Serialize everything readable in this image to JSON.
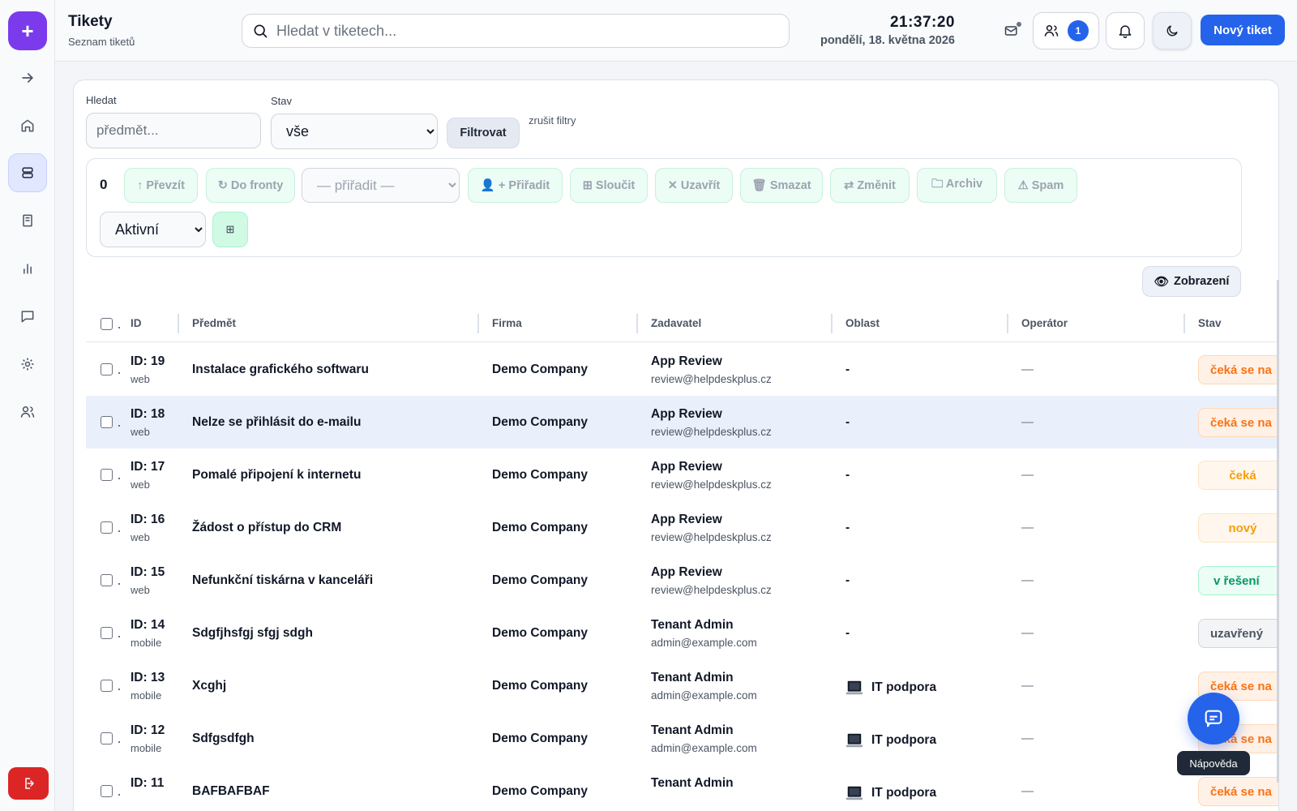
{
  "header": {
    "title": "Tikety",
    "subtitle": "Seznam tiketů",
    "search_placeholder": "Hledat v tiketech...",
    "time": "21:37:20",
    "date": "pondělí, 18. května 2026",
    "users_count": "1",
    "new_ticket_label": "Nový tiket"
  },
  "filters": {
    "search_label": "Hledat",
    "search_placeholder": "předmět...",
    "status_label": "Stav",
    "status_value": "vše",
    "filter_button": "Filtrovat",
    "clear_link": "zrušit filtry"
  },
  "bulk": {
    "selected_count": "0",
    "take_over": "↑ Převzít",
    "to_queue": "↻ Do fronty",
    "assign_select": "— přiřadit —",
    "assign_button": "👤 + Přiřadit",
    "merge": "⊞ Sloučit",
    "close": "✕ Uzavřít",
    "delete": "🗑 Smazat",
    "change": "⇄ Změnit",
    "archive": "🗀 Archiv",
    "spam": "⚠ Spam",
    "scope_select": "Aktivní",
    "grid_icon": "⊞"
  },
  "view_button": "Zobrazení",
  "table": {
    "columns": {
      "id": "ID",
      "subject": "Předmět",
      "company": "Firma",
      "requester": "Zadavatel",
      "area": "Oblast",
      "operator": "Operátor",
      "status": "Stav"
    },
    "rows": [
      {
        "id": "ID: 19",
        "source": "web",
        "subject": "Instalace grafického softwaru",
        "company": "Demo Company",
        "requester": "App Review",
        "email": "review@helpdeskplus.cz",
        "area": "-",
        "operator": "—",
        "status": "čeká se na"
      },
      {
        "id": "ID: 18",
        "source": "web",
        "subject": "Nelze se přihlásit do e-mailu",
        "company": "Demo Company",
        "requester": "App Review",
        "email": "review@helpdeskplus.cz",
        "area": "-",
        "operator": "—",
        "status": "čeká se na"
      },
      {
        "id": "ID: 17",
        "source": "web",
        "subject": "Pomalé připojení k internetu",
        "company": "Demo Company",
        "requester": "App Review",
        "email": "review@helpdeskplus.cz",
        "area": "-",
        "operator": "—",
        "status": "čeká"
      },
      {
        "id": "ID: 16",
        "source": "web",
        "subject": "Žádost o přístup do CRM",
        "company": "Demo Company",
        "requester": "App Review",
        "email": "review@helpdeskplus.cz",
        "area": "-",
        "operator": "—",
        "status": "nový"
      },
      {
        "id": "ID: 15",
        "source": "web",
        "subject": "Nefunkční tiskárna v kanceláři",
        "company": "Demo Company",
        "requester": "App Review",
        "email": "review@helpdeskplus.cz",
        "area": "-",
        "operator": "—",
        "status": "v řešení"
      },
      {
        "id": "ID: 14",
        "source": "mobile",
        "subject": "Sdgfjhsfgj sfgj sdgh",
        "company": "Demo Company",
        "requester": "Tenant Admin",
        "email": "admin@example.com",
        "area": "-",
        "operator": "—",
        "status": "uzavřený"
      },
      {
        "id": "ID: 13",
        "source": "mobile",
        "subject": "Xcghj",
        "company": "Demo Company",
        "requester": "Tenant Admin",
        "email": "admin@example.com",
        "area": "IT podpora",
        "operator": "—",
        "status": "čeká se na"
      },
      {
        "id": "ID: 12",
        "source": "mobile",
        "subject": "Sdfgsdfgh",
        "company": "Demo Company",
        "requester": "Tenant Admin",
        "email": "admin@example.com",
        "area": "IT podpora",
        "operator": "—",
        "status": "čeká se na"
      },
      {
        "id": "ID: 11",
        "source": "",
        "subject": "BAFBAFBAF",
        "company": "Demo Company",
        "requester": "Tenant Admin",
        "email": "",
        "area": "IT podpora",
        "operator": "—",
        "status": "čeká se na"
      }
    ]
  },
  "help": {
    "tooltip": "Nápověda"
  }
}
